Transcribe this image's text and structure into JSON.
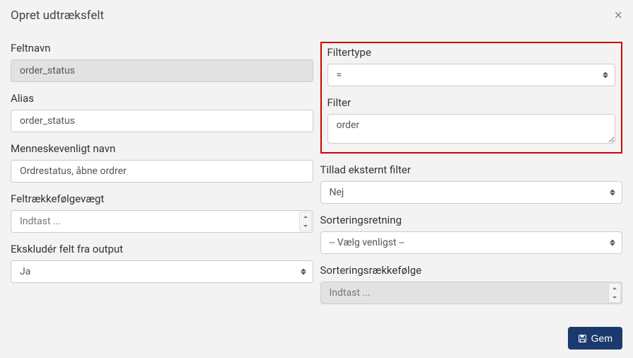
{
  "header": {
    "title": "Opret udtræksfelt",
    "close": "×"
  },
  "left": {
    "feltnavn": {
      "label": "Feltnavn",
      "value": "order_status"
    },
    "alias": {
      "label": "Alias",
      "value": "order_status"
    },
    "menneske": {
      "label": "Menneskevenligt navn",
      "value": "Ordrestatus, åbne ordrer"
    },
    "feltvaegt": {
      "label": "Feltrækkefølgevægt",
      "placeholder": "Indtast ..."
    },
    "ekskluder": {
      "label": "Ekskludér felt fra output",
      "value": "Ja"
    }
  },
  "right": {
    "filtertype": {
      "label": "Filtertype",
      "value": "="
    },
    "filter": {
      "label": "Filter",
      "value": "order"
    },
    "tilladeksternt": {
      "label": "Tillad eksternt filter",
      "value": "Nej"
    },
    "sorteringsretning": {
      "label": "Sorteringsretning",
      "value": "-- Vælg venligst --"
    },
    "sorteringsraekke": {
      "label": "Sorteringsrækkefølge",
      "placeholder": "Indtast ..."
    }
  },
  "footer": {
    "save": "Gem"
  }
}
